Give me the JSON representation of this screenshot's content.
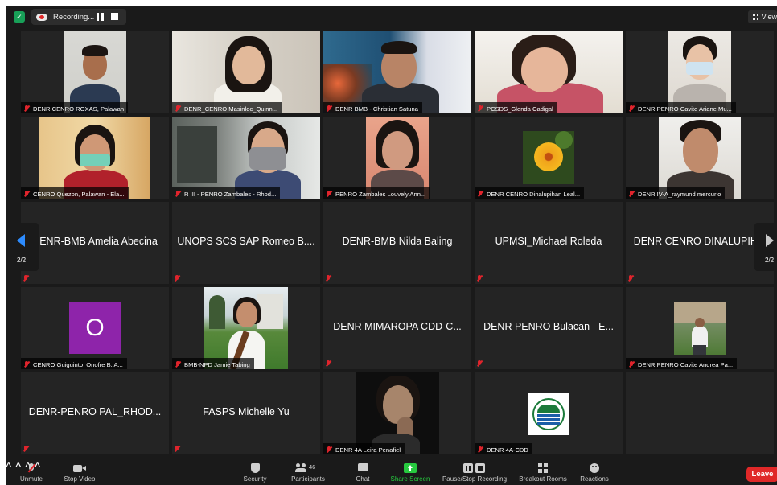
{
  "topbar": {
    "recording_label": "Recording...",
    "view_label": "View"
  },
  "pagination": {
    "left": "2/2",
    "right": "2/2"
  },
  "participants": [
    {
      "name": "DENR CENRO ROXAS, Palawan",
      "video": true
    },
    {
      "name": "DENR_CENRO Masinloc_Quinn...",
      "video": true
    },
    {
      "name": "DENR BMB - Christian Satuna",
      "video": true
    },
    {
      "name": "PCSDS_Glenda Cadigal",
      "video": true
    },
    {
      "name": "DENR PENRO Cavite Ariane Mu...",
      "video": true
    },
    {
      "name": "CENRO Quezon, Palawan - Ela...",
      "video": true
    },
    {
      "name": "R III - PENRO Zambales - Rhod...",
      "video": true
    },
    {
      "name": "PENRO Zambales Louvely Ann...",
      "video": true
    },
    {
      "name": "DENR CENRO Dinalupihan Leal...",
      "video": true
    },
    {
      "name": "DENR IV-A_raymund mercurio",
      "video": true
    },
    {
      "name": "DENR-BMB Amelia Abecina",
      "video": false
    },
    {
      "name": "UNOPS SCS SAP Romeo B....",
      "video": false
    },
    {
      "name": "DENR-BMB Nilda Baling",
      "video": false
    },
    {
      "name": "UPMSI_Michael Roleda",
      "video": false
    },
    {
      "name": "DENR CENRO DINALUPIH...",
      "video": false
    },
    {
      "name": "CENRO Guiguinto_Onofre B. A...",
      "video": true,
      "avatar_letter": "O"
    },
    {
      "name": "BMB-NPD Jamie Tabing",
      "video": true
    },
    {
      "name": "DENR MIMAROPA CDD-C...",
      "video": false
    },
    {
      "name": "DENR PENRO Bulacan - E...",
      "video": false
    },
    {
      "name": "DENR PENRO Cavite Andrea Pa...",
      "video": true
    },
    {
      "name": "DENR-PENRO PAL_RHOD...",
      "video": false
    },
    {
      "name": "FASPS Michelle Yu",
      "video": false
    },
    {
      "name": "DENR 4A Leira Penafiel",
      "video": true
    },
    {
      "name": "DENR 4A-CDD",
      "video": true
    }
  ],
  "toolbar": {
    "unmute": "Unmute",
    "stop_video": "Stop Video",
    "security": "Security",
    "participants": "Participants",
    "participants_count": "46",
    "chat": "Chat",
    "share_screen": "Share Screen",
    "pause_stop_recording": "Pause/Stop Recording",
    "breakout_rooms": "Breakout Rooms",
    "reactions": "Reactions",
    "leave": "Leave"
  },
  "colors": {
    "window_bg": "#1a1a1a",
    "tile_bg": "#242424",
    "muted_red": "#e0242c",
    "share_green": "#27c93f",
    "leave_red": "#e02828",
    "avatar_purple": "#8e24aa",
    "page_arrow_blue": "#2d8cff"
  }
}
